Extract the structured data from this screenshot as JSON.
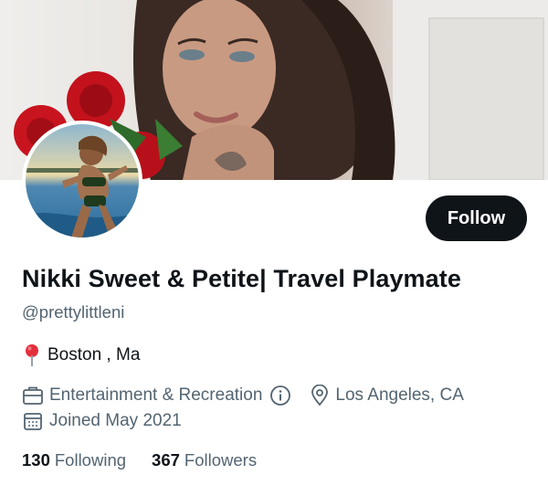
{
  "profile": {
    "display_name": "Nikki Sweet & Petite| Travel Playmate",
    "handle": "@prettylittleni",
    "location_bio": "Boston , Ma",
    "category": "Entertainment & Recreation",
    "location": "Los Angeles, CA",
    "joined": "Joined May 2021"
  },
  "actions": {
    "follow_label": "Follow"
  },
  "stats": {
    "following_count": "130",
    "following_label": "Following",
    "followers_count": "367",
    "followers_label": "Followers"
  },
  "icons": {
    "pin": "round-pushpin-icon",
    "category": "briefcase-icon",
    "info": "info-icon",
    "location": "location-pin-icon",
    "calendar": "calendar-icon"
  },
  "colors": {
    "text_primary": "#0f1419",
    "text_secondary": "#536471",
    "button_bg": "#0f1419",
    "button_text": "#ffffff",
    "pin_red": "#e2303c"
  }
}
